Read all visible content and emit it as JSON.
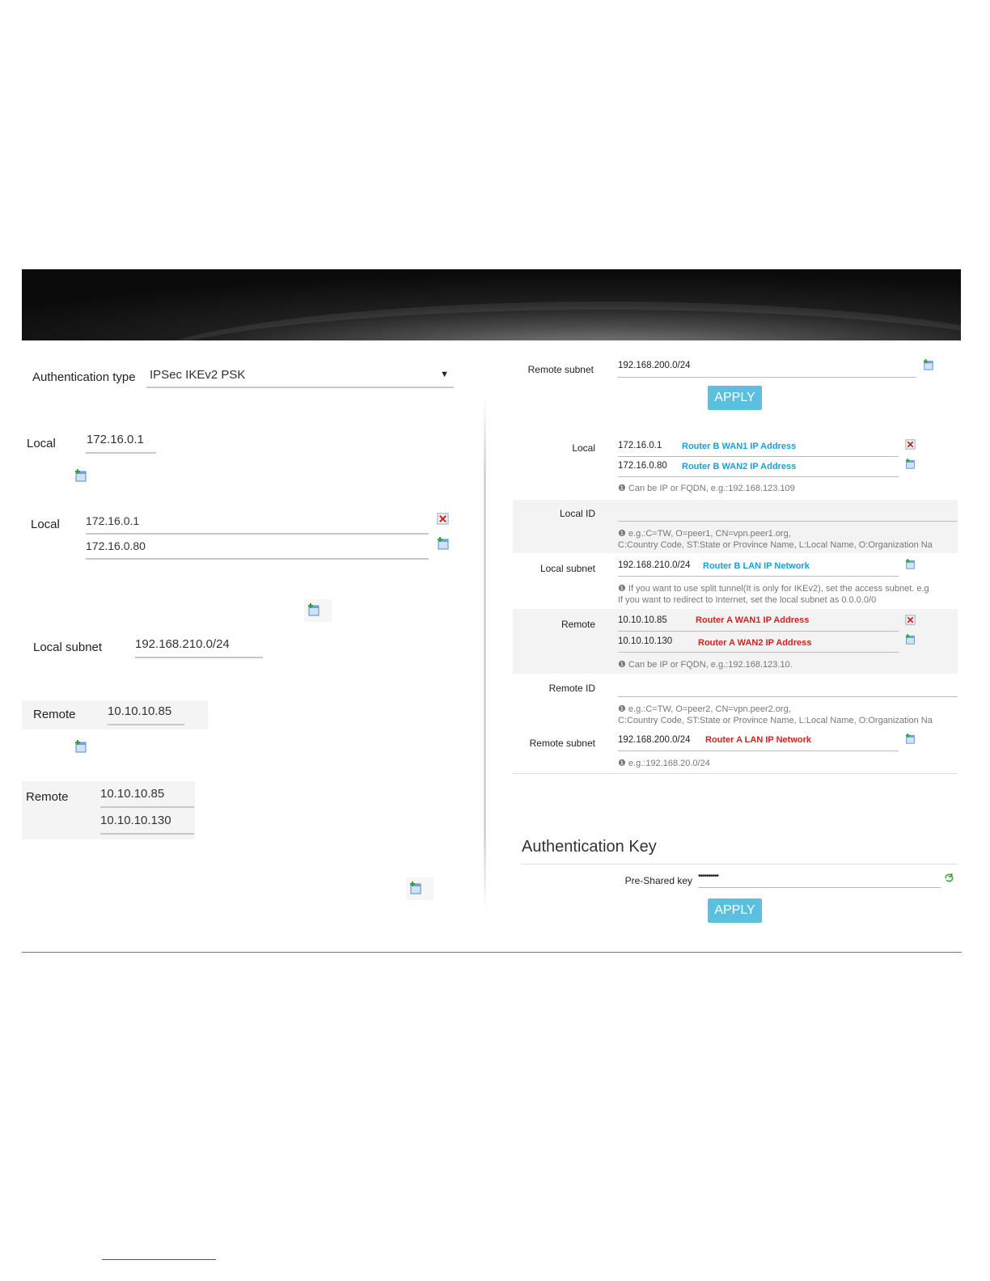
{
  "left": {
    "auth_type": {
      "label": "Authentication type",
      "value": "IPSec IKEv2 PSK",
      "arrow": "▼"
    },
    "local_single": {
      "label": "Local",
      "value": "172.16.0.1"
    },
    "local_multi": {
      "label": "Local",
      "values": [
        "172.16.0.1",
        "172.16.0.80"
      ]
    },
    "local_subnet": {
      "label": "Local subnet",
      "value": "192.168.210.0/24"
    },
    "remote_single": {
      "label": "Remote",
      "value": "10.10.10.85"
    },
    "remote_multi": {
      "label": "Remote",
      "values": [
        "10.10.10.85",
        "10.10.10.130"
      ]
    }
  },
  "right": {
    "remote_subnet_top": {
      "label": "Remote subnet",
      "value": "192.168.200.0/24"
    },
    "apply_label": "APPLY",
    "local": {
      "label": "Local",
      "values": [
        "172.16.0.1",
        "172.16.0.80"
      ],
      "notes": [
        "Router B WAN1 IP Address",
        "Router B WAN2 IP Address"
      ],
      "help": "Can be IP or FQDN, e.g.:192.168.123.109"
    },
    "local_id": {
      "label": "Local ID",
      "value": "",
      "help_line1": "e.g.:C=TW, O=peer1, CN=vpn.peer1.org,",
      "help_line2": "C:Country Code, ST:State or Province Name, L:Local Name, O:Organization Na"
    },
    "local_subnet": {
      "label": "Local subnet",
      "value": "192.168.210.0/24",
      "note": "Router B LAN IP Network",
      "help_line1": "If you want to use split tunnel(It is only for IKEv2), set the access subnet. e.g",
      "help_line2": "If you want to redirect to Internet, set the local subnet as 0.0.0.0/0"
    },
    "remote": {
      "label": "Remote",
      "values": [
        "10.10.10.85",
        "10.10.10.130"
      ],
      "notes": [
        "Router A WAN1 IP Address",
        "Router A WAN2 IP Address"
      ],
      "help": "Can be IP or FQDN, e.g.:192.168.123.10."
    },
    "remote_id": {
      "label": "Remote ID",
      "value": "",
      "help_line1": "e.g.:C=TW, O=peer2, CN=vpn.peer2.org,",
      "help_line2": "C:Country Code, ST:State or Province Name, L:Local Name, O:Organization Na"
    },
    "remote_subnet": {
      "label": "Remote subnet",
      "value": "192.168.200.0/24",
      "note": "Router A LAN IP Network",
      "help": "e.g.:192.168.20.0/24"
    },
    "auth_key": {
      "heading": "Authentication Key",
      "label": "Pre-Shared key",
      "value": "••••••••••"
    },
    "apply_label_2": "APPLY"
  },
  "colors": {
    "accent": "#5bc0de",
    "note_blue": "#1a9fd6",
    "note_red": "#d62020",
    "rule": "#4a7fc1"
  },
  "icons": [
    "add-icon",
    "delete-icon",
    "refresh-icon",
    "info-icon",
    "chevron-down-icon"
  ]
}
